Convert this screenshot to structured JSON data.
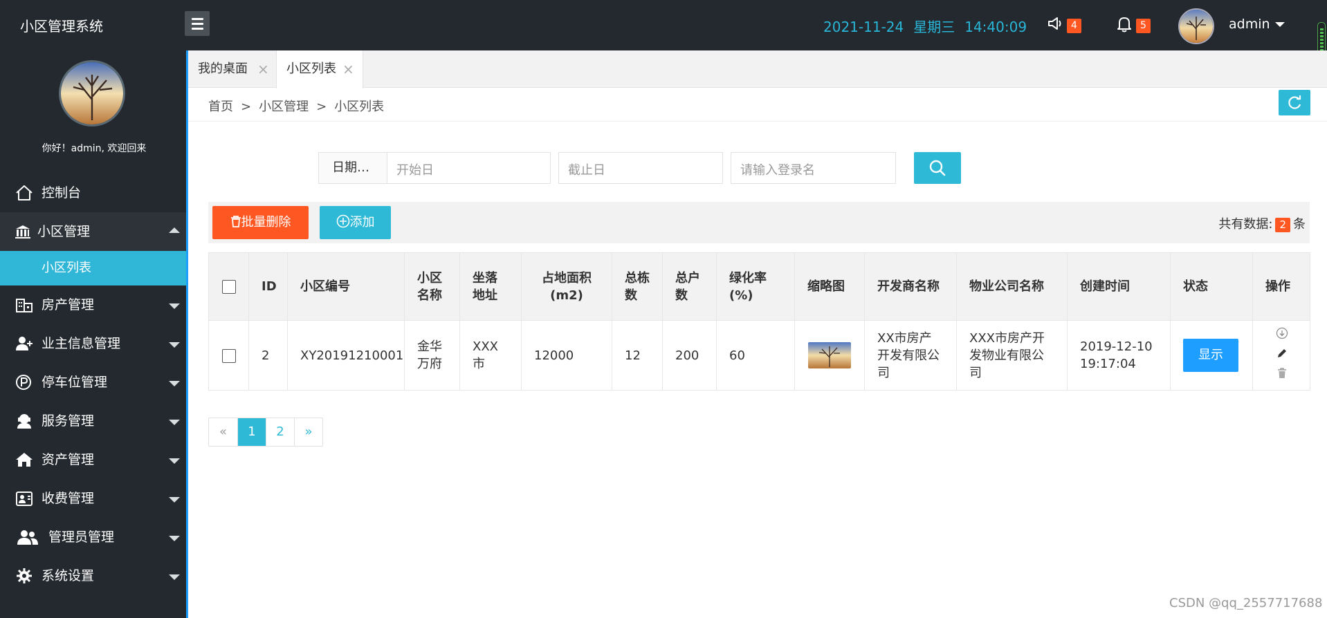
{
  "app": {
    "title": "小区管理系统"
  },
  "header": {
    "date": "2021-11-24",
    "weekday": "星期三",
    "time": "14:40:09",
    "announce_count": "4",
    "notify_count": "5",
    "username": "admin",
    "icons": {
      "menu": "hamburger-icon",
      "announce": "megaphone-icon",
      "notify": "bell-icon"
    }
  },
  "sidebar": {
    "welcome": "你好！admin, 欢迎回来",
    "items": [
      {
        "label": "控制台",
        "icon": "home-icon"
      },
      {
        "label": "小区管理",
        "icon": "building-icon",
        "expanded": true,
        "children": [
          {
            "label": "小区列表",
            "active": true
          }
        ]
      },
      {
        "label": "房产管理",
        "icon": "house-grid-icon"
      },
      {
        "label": "业主信息管理",
        "icon": "user-add-icon"
      },
      {
        "label": "停车位管理",
        "icon": "parking-icon"
      },
      {
        "label": "服务管理",
        "icon": "service-icon"
      },
      {
        "label": "资产管理",
        "icon": "home-fill-icon"
      },
      {
        "label": "收费管理",
        "icon": "billing-icon"
      },
      {
        "label": "管理员管理",
        "icon": "users-icon"
      },
      {
        "label": "系统设置",
        "icon": "gear-icon"
      }
    ]
  },
  "tabs": [
    {
      "label": "我的桌面",
      "active": false
    },
    {
      "label": "小区列表",
      "active": true
    }
  ],
  "breadcrumb": [
    "首页",
    "小区管理",
    "小区列表"
  ],
  "search": {
    "date_label": "日期…",
    "start_placeholder": "开始日",
    "end_placeholder": "截止日",
    "login_placeholder": "请输入登录名"
  },
  "toolbar": {
    "batch_delete": "批量删除",
    "add": "添加",
    "total_prefix": "共有数据:",
    "total_count": "2",
    "total_suffix": "条"
  },
  "table": {
    "headers": [
      "ID",
      "小区编号",
      "小区名称",
      "坐落地址",
      "占地面积(m2)",
      "总栋数",
      "总户数",
      "绿化率(%)",
      "缩略图",
      "开发商名称",
      "物业公司名称",
      "创建时间",
      "状态",
      "操作"
    ],
    "rows": [
      {
        "id": "2",
        "code": "XY20191210001",
        "name": "金华万府",
        "address": "XXX市",
        "area": "12000",
        "buildings": "12",
        "households": "200",
        "green_rate": "60",
        "developer": "XX市房产开发有限公司",
        "property_company": "XXX市房产开发物业有限公司",
        "created_date": "2019-12-10",
        "created_time": "19:17:04",
        "status": "显示"
      }
    ]
  },
  "pagination": {
    "prev": "«",
    "pages": [
      "1",
      "2"
    ],
    "current": "1",
    "next": "»"
  },
  "watermark": "CSDN @qq_2557717688",
  "colors": {
    "accent": "#2eb9d7",
    "danger": "#ff5722",
    "primary": "#1e9fff",
    "sidebar": "#23292e"
  }
}
